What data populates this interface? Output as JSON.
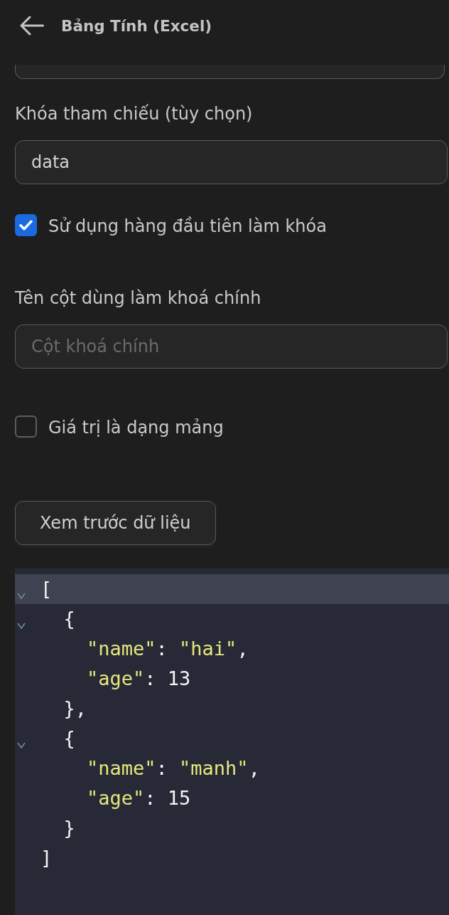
{
  "header": {
    "title": "Bảng Tính (Excel)"
  },
  "form": [
    {
      "kind": "field",
      "partial": true
    },
    {
      "kind": "field",
      "partial": false,
      "label": "Khóa tham chiếu (tùy chọn)",
      "value": "data"
    },
    {
      "kind": "checkbox",
      "label": "Sử dụng hàng đầu tiên làm khóa",
      "checked": true
    },
    {
      "kind": "field",
      "partial": false,
      "label": "Tên cột dùng làm khoá chính",
      "placeholder": "Cột khoá chính"
    },
    {
      "kind": "checkbox",
      "label": "Giá trị là dạng mảng",
      "checked": false
    },
    {
      "kind": "button",
      "label": "Xem trước dữ liệu"
    }
  ],
  "preview": {
    "lines": [
      {
        "kind": "fold",
        "expanded": true,
        "text": "[",
        "current": true
      },
      {
        "kind": "fold",
        "expanded": true,
        "text": "  {",
        "current": false
      },
      {
        "kind": "plain",
        "text": "    \"name\": \"hai\",",
        "current": false
      },
      {
        "kind": "plain",
        "text": "    \"age\": 13",
        "current": false
      },
      {
        "kind": "plain",
        "text": "  },",
        "current": false
      },
      {
        "kind": "fold",
        "expanded": true,
        "text": "  {",
        "current": false
      },
      {
        "kind": "plain",
        "text": "    \"name\": \"manh\",",
        "current": false
      },
      {
        "kind": "plain",
        "text": "    \"age\": 15",
        "current": false
      },
      {
        "kind": "plain",
        "text": "  }",
        "current": false
      },
      {
        "kind": "plain",
        "text": "]",
        "current": false
      }
    ]
  }
}
